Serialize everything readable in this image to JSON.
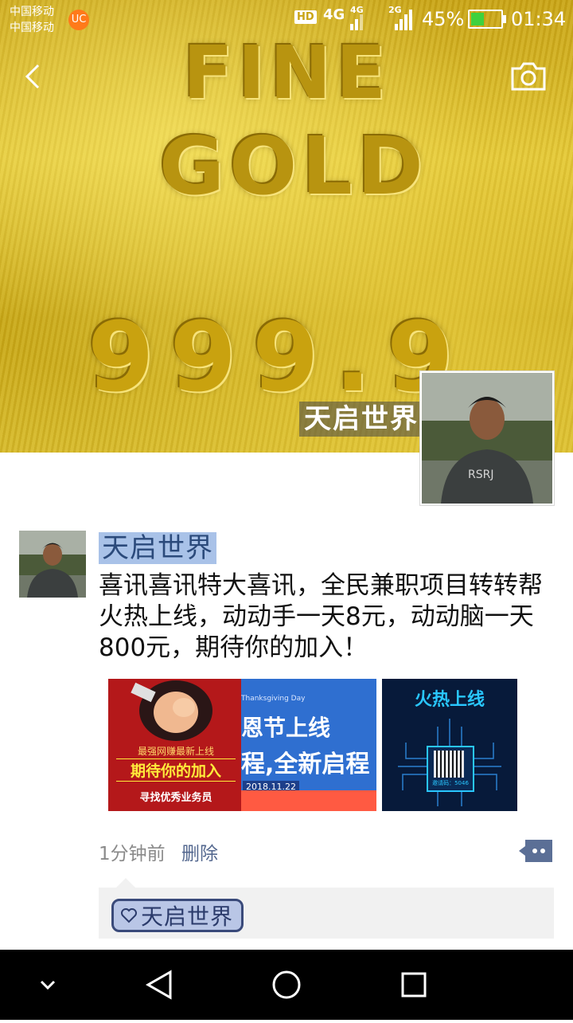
{
  "status_bar": {
    "carrier_1": "中国移动",
    "carrier_2": "中国移动",
    "hd_label": "HD",
    "network_4g": "4G",
    "network_4g_small": "4G",
    "network_2g": "2G",
    "battery_percent": "45%",
    "battery_level": 0.45,
    "time": "01:34",
    "uc_icon": "uc-browser-icon"
  },
  "cover": {
    "engraving_line1": "FINE",
    "engraving_line2": "GOLD",
    "engraving_line3": "999.9",
    "profile_name": "天启世界"
  },
  "header": {
    "back_icon": "back-chevron-icon",
    "camera_icon": "camera-icon"
  },
  "post": {
    "author": "天启世界",
    "text": "喜讯喜讯特大喜讯，全民兼职项目转转帮火热上线，动动手一天8元，动动脑一天800元，期待你的加入！",
    "images": [
      {
        "sub": "最强网赚最新上线",
        "title": "期待你的加入",
        "foot": "寻找优秀业务员"
      },
      {
        "small": "Thanksgiving Day",
        "line1": "恩节上线",
        "line2": "程,全新启程",
        "date": "2018.11.22"
      },
      {
        "title": "火热上线",
        "code": "邀请码：5046"
      }
    ],
    "time": "1分钟前",
    "delete_label": "删除"
  },
  "likes": {
    "names": [
      "天启世界"
    ]
  }
}
